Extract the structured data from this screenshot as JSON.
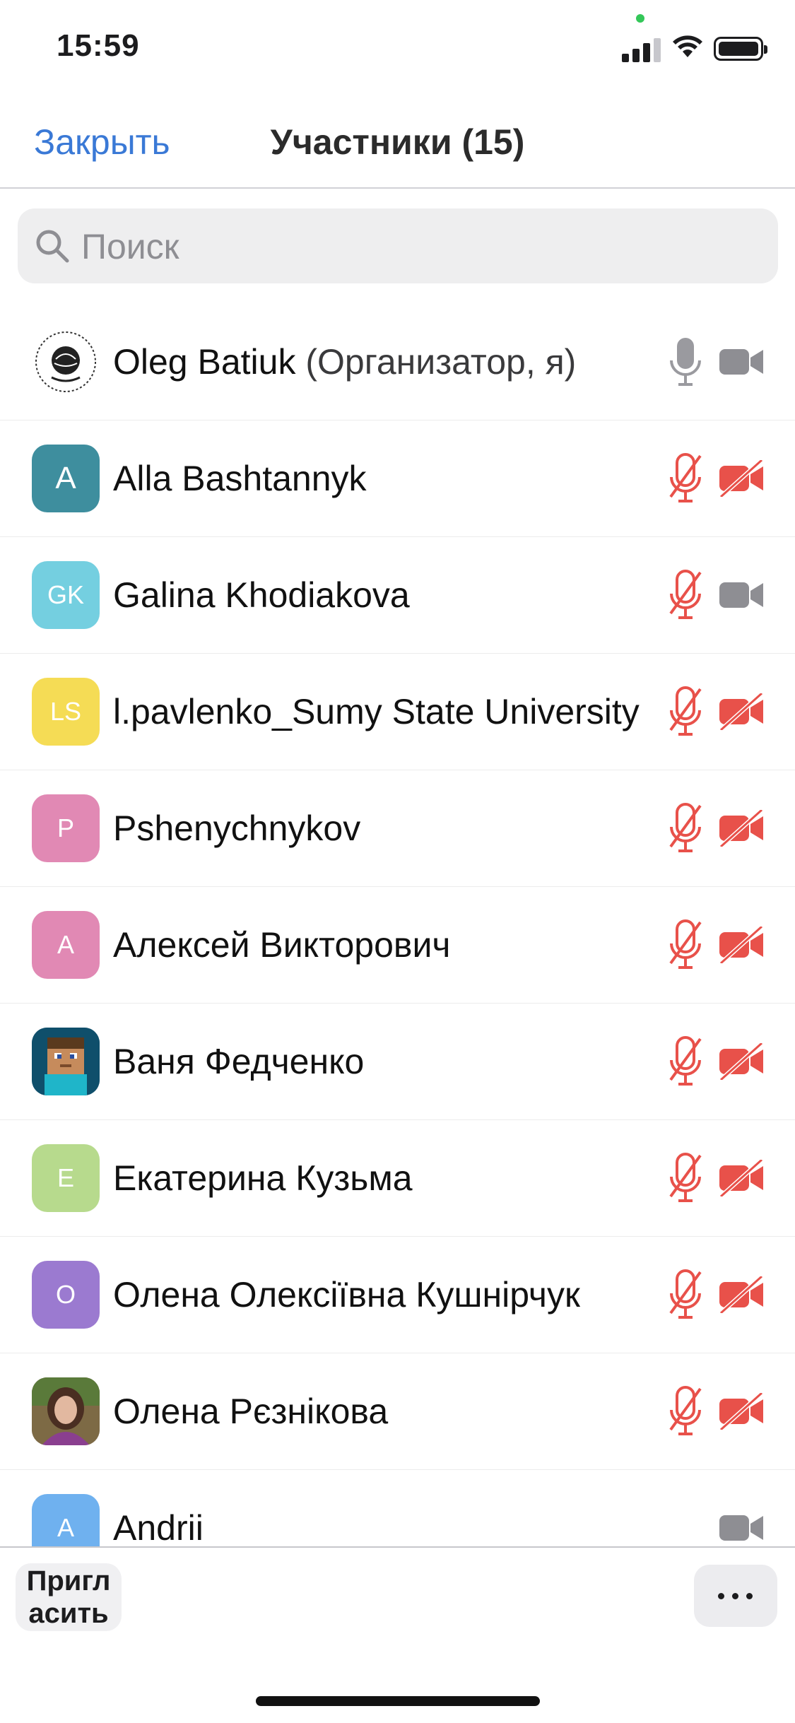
{
  "status_bar": {
    "time": "15:59"
  },
  "nav": {
    "close_label": "Закрыть",
    "title": "Участники (15)"
  },
  "search": {
    "placeholder": "Поиск"
  },
  "participants": [
    {
      "name": "Oleg Batiuk",
      "role": "(Организатор, я)",
      "avatar_type": "logo",
      "mic": "on",
      "video": "on"
    },
    {
      "name": "Alla Bashtannyk",
      "initials": "A",
      "avatar_color": "#3e8e9e",
      "mic": "muted",
      "video": "off"
    },
    {
      "name": "Galina Khodiakova",
      "initials": "GK",
      "avatar_color": "#74cfe0",
      "mic": "muted",
      "video": "on"
    },
    {
      "name": "l.pavlenko_Sumy State University",
      "initials": "LS",
      "avatar_color": "#f5dc55",
      "mic": "muted",
      "video": "off"
    },
    {
      "name": "Pshenychnykov",
      "initials": "P",
      "avatar_color": "#e189b4",
      "mic": "muted",
      "video": "off"
    },
    {
      "name": "Алексей Викторович",
      "initials": "A",
      "avatar_color": "#e189b4",
      "mic": "muted",
      "video": "off"
    },
    {
      "name": "Ваня Федченко",
      "avatar_type": "photo-minecraft",
      "mic": "muted",
      "video": "off"
    },
    {
      "name": "Екатерина Кузьма",
      "initials": "E",
      "avatar_color": "#b7da8d",
      "mic": "muted",
      "video": "off"
    },
    {
      "name": "Олена Олексіївна Кушнірчук",
      "initials": "O",
      "avatar_color": "#9b7ad0",
      "mic": "muted",
      "video": "off"
    },
    {
      "name": "Олена Рєзнікова",
      "avatar_type": "photo-person",
      "mic": "muted",
      "video": "off"
    },
    {
      "name": "Andrii",
      "initials": "A",
      "avatar_color": "#6fb1ef",
      "mic": "none",
      "video": "on"
    }
  ],
  "footer": {
    "invite_label": "Пригл асить",
    "invite_line1": "Пригл",
    "invite_line2": "асить",
    "more_icon": "ellipsis-icon"
  },
  "colors": {
    "accent": "#3a79d6",
    "muted_red": "#e8514a",
    "icon_gray": "#8e8e93"
  }
}
